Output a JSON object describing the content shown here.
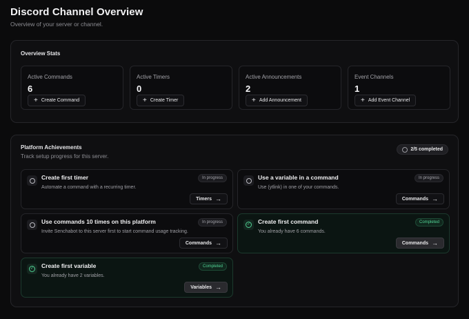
{
  "header": {
    "title": "Discord Channel Overview",
    "subtitle": "Overview of your server or channel."
  },
  "overview": {
    "title": "Overview Stats",
    "stats": [
      {
        "label": "Active Commands",
        "value": "6",
        "button": "Create Command"
      },
      {
        "label": "Active Timers",
        "value": "0",
        "button": "Create Timer"
      },
      {
        "label": "Active Announcements",
        "value": "2",
        "button": "Add Announcement"
      },
      {
        "label": "Event Channels",
        "value": "1",
        "button": "Add Event Channel"
      }
    ]
  },
  "achievements": {
    "title": "Platform Achievements",
    "subtitle": "Track setup progress for this server.",
    "progress": "2/5 completed",
    "items": [
      {
        "name": "Create first timer",
        "desc": "Automate a command with a recurring timer.",
        "status": "In progress",
        "action": "Timers",
        "completed": false
      },
      {
        "name": "Use a variable in a command",
        "desc": "Use (ytlink) in one of your commands.",
        "status": "In progress",
        "action": "Commands",
        "completed": false
      },
      {
        "name": "Use commands 10 times on this platform",
        "desc": "Invite Senchabot to this server first to start command usage tracking.",
        "status": "In progress",
        "action": "Commands",
        "completed": false
      },
      {
        "name": "Create first command",
        "desc": "You already have 6 commands.",
        "status": "Completed",
        "action": "Commands",
        "completed": true
      },
      {
        "name": "Create first variable",
        "desc": "You already have 2 variables.",
        "status": "Completed",
        "action": "Variables",
        "completed": true
      }
    ]
  },
  "icons": {
    "plus": "plus-icon",
    "arrow": "arrow-right-icon",
    "circle": "circle-icon",
    "check": "check-circle-icon"
  },
  "colors": {
    "background": "#0b0b0c",
    "completed_accent": "#53d597"
  }
}
